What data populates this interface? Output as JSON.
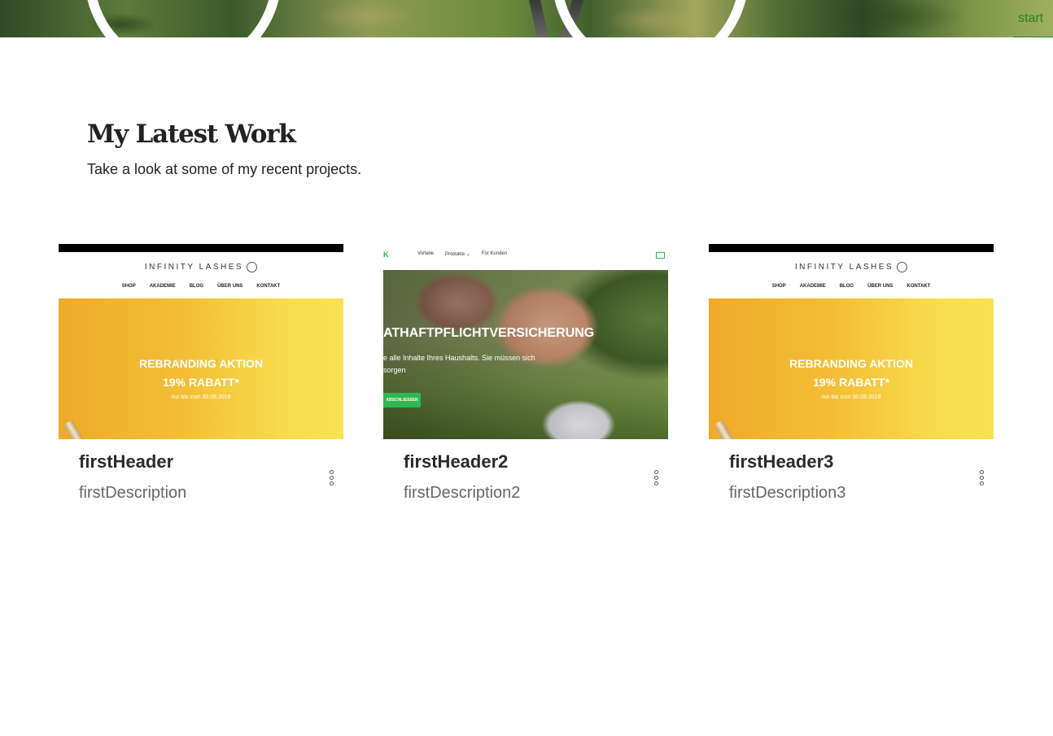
{
  "hero": {
    "link_label": "start"
  },
  "section": {
    "title": "My Latest Work",
    "subtitle": "Take a look at some of my recent projects."
  },
  "projects": [
    {
      "title": "firstHeader",
      "description": "firstDescription",
      "thumbnail": {
        "brand": "INFINITY LASHES",
        "nav": [
          "SHOP",
          "AKADEMIE",
          "BLOG",
          "ÜBER UNS",
          "KONTAKT"
        ],
        "banner_line1": "REBRANDING AKTION",
        "banner_line2": "19% RABATT*",
        "banner_line3": "nur bis zum 30.09.2018"
      }
    },
    {
      "title": "firstHeader2",
      "description": "firstDescription2",
      "thumbnail": {
        "logo": "K",
        "nav": [
          "Vorteile",
          "Produkte ⌄",
          "Für Kunden"
        ],
        "headline": "ATHAFTPFLICHTVERSICHERUNG",
        "text_line1": "e alle Inhalte Ihres Haushalts. Sie müssen sich",
        "text_line2": "sorgen",
        "cta": "ABSCHLIESSEN"
      }
    },
    {
      "title": "firstHeader3",
      "description": "firstDescription3",
      "thumbnail": {
        "brand": "INFINITY LASHES",
        "nav": [
          "SHOP",
          "AKADEMIE",
          "BLOG",
          "ÜBER UNS",
          "KONTAKT"
        ],
        "banner_line1": "REBRANDING AKTION",
        "banner_line2": "19% RABATT*",
        "banner_line3": "nur bis zum 30.09.2018"
      }
    }
  ],
  "colors": {
    "link_green": "#2a7d2a",
    "banner_yellow": "#f3bf36",
    "insurance_green": "#2eb84f"
  },
  "icons": {
    "more": "more-vertical-icon"
  }
}
